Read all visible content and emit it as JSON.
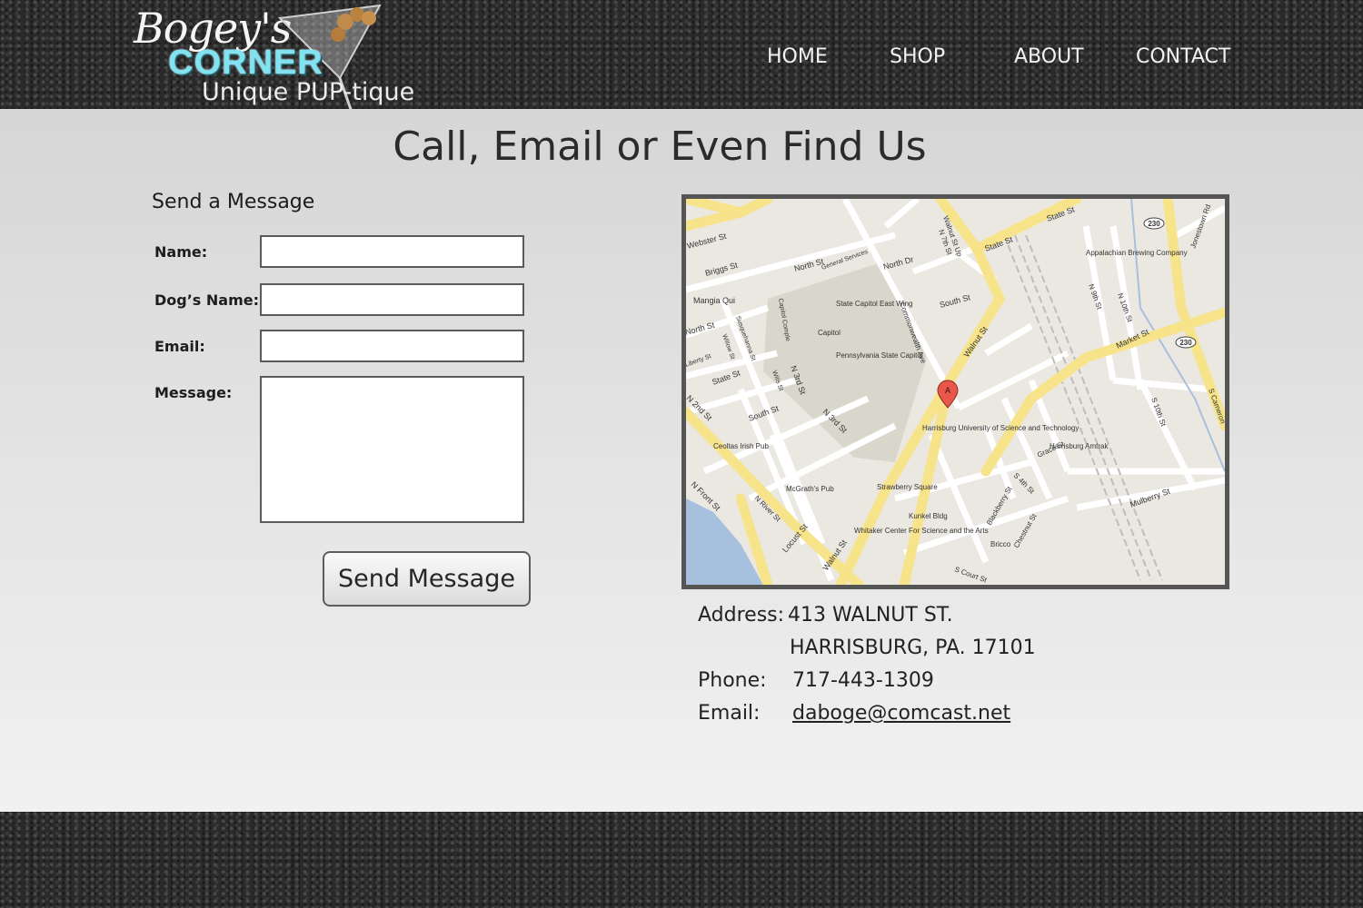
{
  "header": {
    "logo": {
      "script": "Bogey's",
      "corner": "CORNER",
      "tagline": "Unique PUP-tique"
    },
    "nav": [
      {
        "label": "HOME"
      },
      {
        "label": "SHOP"
      },
      {
        "label": "ABOUT"
      },
      {
        "label": "CONTACT"
      }
    ]
  },
  "page": {
    "title": "Call, Email or Even Find Us"
  },
  "form": {
    "heading": "Send a Message",
    "fields": {
      "name": {
        "label": "Name:",
        "value": ""
      },
      "dog_name": {
        "label": "Dog’s Name:",
        "value": ""
      },
      "email": {
        "label": "Email:",
        "value": ""
      },
      "message": {
        "label": "Message:",
        "value": ""
      }
    },
    "submit_label": "Send Message"
  },
  "map": {
    "marker": "A",
    "labels": {
      "walnut_st_up": "Walnut St Up",
      "n7th": "N 7th St",
      "state_st": "State St",
      "state_st2": "State St",
      "webster": "Webster St",
      "briggs": "Briggs St",
      "north_st": "North St",
      "general_services": "General Services",
      "north_dr": "North Dr",
      "mangia": "Mangia Qui",
      "state_capitol_east": "State Capitol East Wing",
      "capitol": "Capitol",
      "pa_state_capitol": "Pennsylvania State Capitol",
      "commonwealth": "Commonwealth Ave",
      "south_st": "South St",
      "walnut_st": "Walnut St",
      "market_st": "Market St",
      "harrisburg_univ": "Harrisburg University of Science and Technology",
      "amtrak": "Harrisburg Amtrak",
      "appalachian": "Appalachian Brewing Company",
      "route230a": "230",
      "route230b": "230",
      "jonestown": "Jonestown Rd",
      "n9th": "N 9th St",
      "n10th": "N 10th St",
      "s10th": "S 10th St",
      "s_cameron": "S Cameron",
      "mulberry": "Mulberry St",
      "ceoltas": "Ceoltas Irish Pub",
      "mcgraths": "McGrath's Pub",
      "strawberry": "Strawberry Square",
      "kunkel": "Kunkel Bldg",
      "whitaker": "Whitaker Center For Science and the Arts",
      "bricco": "Bricco",
      "n_front": "N Front St",
      "n_river": "N River St",
      "locust": "Locust St",
      "walnut_low": "Walnut St",
      "s_court": "S Court St",
      "chestnut": "Chestnut St",
      "blackberry": "Blackberry St",
      "s4th": "S 4th St",
      "grace": "Grace St",
      "n3rd": "N 3rd St",
      "n3rd_b": "N 3rd St",
      "south_st_w": "South St",
      "state_st_w": "State St",
      "n2nd": "N 2nd St",
      "liberty": "Liberty St",
      "north_st_w": "North St",
      "susquehanna": "Susquehanna St",
      "willow": "Willow St",
      "wills": "Wills St",
      "capitol_complex": "Capitol Comple"
    }
  },
  "contact": {
    "address_label": "Address:",
    "address_line1": "413 WALNUT ST.",
    "address_line2": "HARRISBURG, PA. 17101",
    "phone_label": "Phone:",
    "phone": "717-443-1309",
    "email_label": "Email:",
    "email": "daboge@comcast.net"
  },
  "colors": {
    "accent": "#7fe3f2",
    "road": "#f7e38a",
    "water": "#a7c0dd"
  }
}
